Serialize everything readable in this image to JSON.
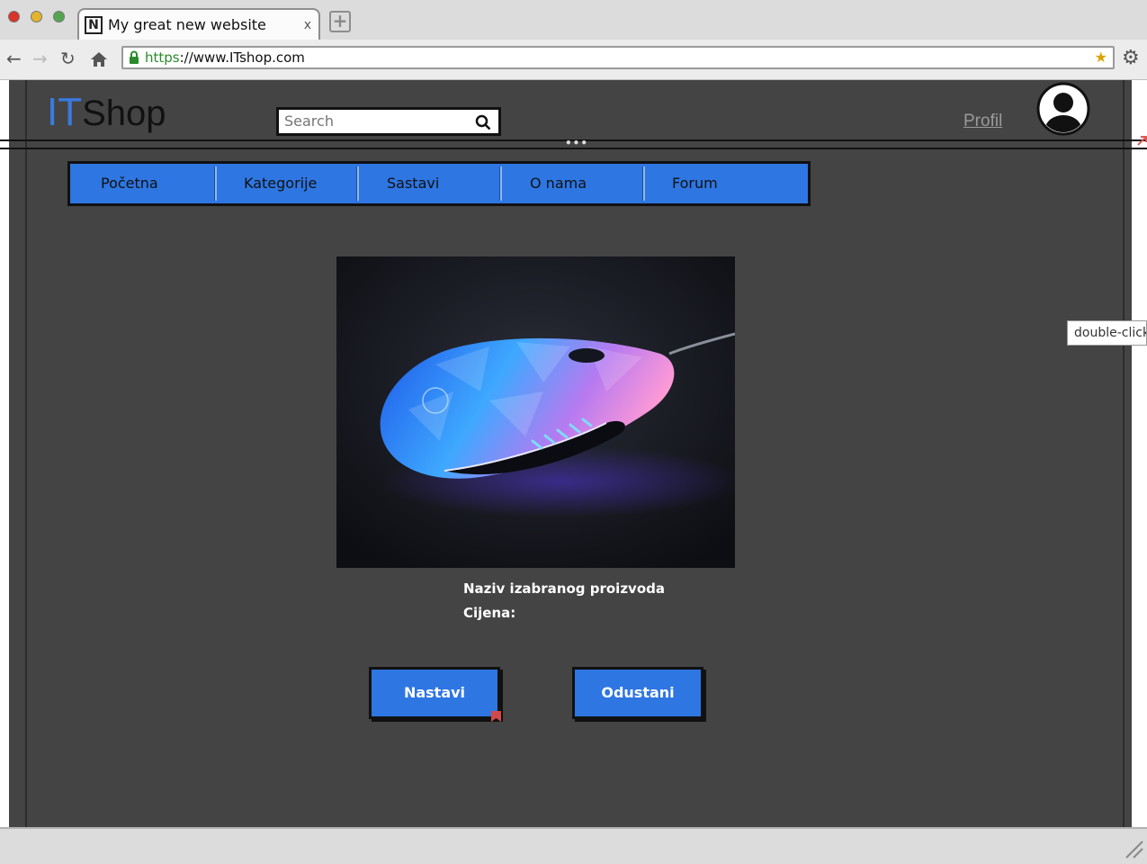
{
  "browser": {
    "tab_title": "My great new website",
    "tab_favicon": "N",
    "tab_close": "x",
    "new_tab": "+",
    "url_scheme": "https",
    "url_rest": "://www.ITshop.com",
    "icons": [
      "back-icon",
      "forward-icon",
      "reload-icon",
      "home-icon",
      "lock-icon",
      "bookmark-icon",
      "settings-icon",
      "resize-grip-icon"
    ]
  },
  "site": {
    "logo_it": "IT",
    "logo_shop": "Shop",
    "search_placeholder": "Search",
    "profile_link": "Profil",
    "menu": [
      "Početna",
      "Kategorije",
      "Sastavi",
      "O nama",
      "Forum"
    ],
    "product_name_label": "Naziv izabranog proizvoda",
    "price_label": "Cijena:",
    "continue_button": "Nastavi",
    "cancel_button": "Odustani",
    "product_image_alt": "gaming-mouse-image",
    "tooltip": "double-click"
  },
  "colors": {
    "accent_blue": "#2e76e2",
    "page_background": "#444444",
    "logo_it": "#3a7ae0",
    "url_scheme": "#2a8a2a"
  }
}
